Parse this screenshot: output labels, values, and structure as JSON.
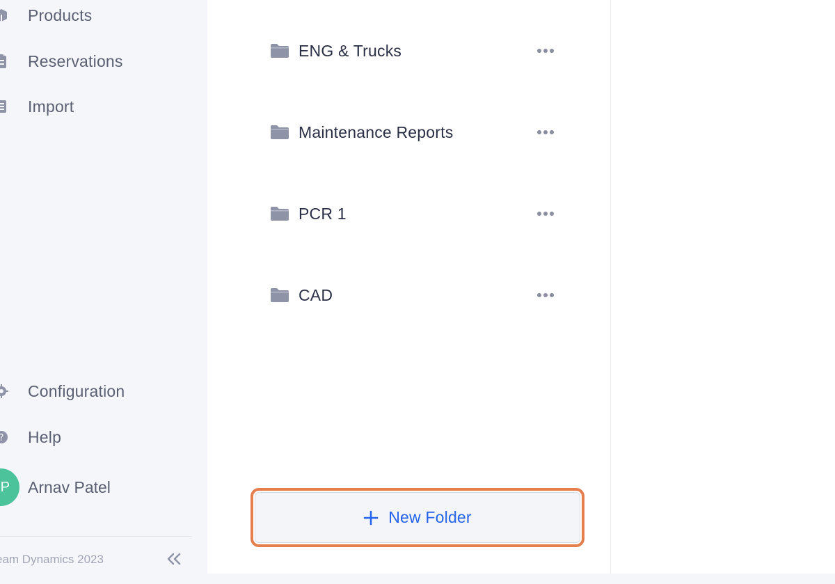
{
  "sidebar": {
    "items": [
      {
        "label": "Products",
        "icon": "products-icon"
      },
      {
        "label": "Reservations",
        "icon": "clipboard-icon"
      },
      {
        "label": "Import",
        "icon": "import-icon"
      }
    ],
    "bottom_items": [
      {
        "label": "Configuration",
        "icon": "gear-icon"
      },
      {
        "label": "Help",
        "icon": "help-icon"
      }
    ],
    "user": {
      "name": "Arnav Patel",
      "initials_visible": "P"
    },
    "copyright": "eam Dynamics 2023",
    "collapse_icon": "double-chevron-left-icon"
  },
  "folders": [
    {
      "label": "ENG & Trucks"
    },
    {
      "label": "Maintenance Reports"
    },
    {
      "label": "PCR 1"
    },
    {
      "label": "CAD"
    }
  ],
  "new_folder": {
    "label": "New Folder",
    "icon": "plus-icon"
  },
  "colors": {
    "accent": "#2563eb",
    "highlight": "#e67e4d",
    "avatar": "#4cc39a",
    "folder_icon": "#8f93a8"
  }
}
